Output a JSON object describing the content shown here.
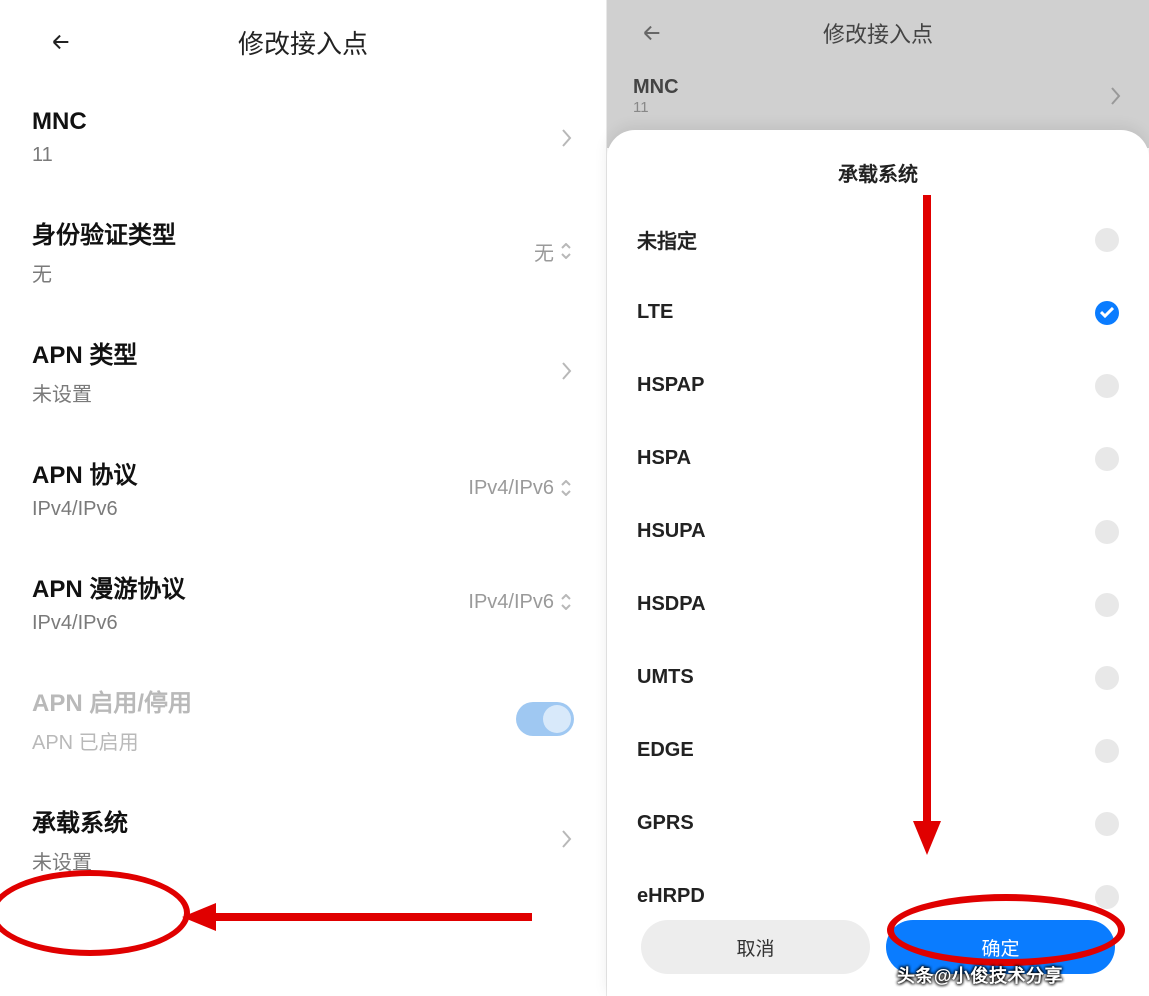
{
  "left": {
    "page_title": "修改接入点",
    "rows": [
      {
        "title": "MNC",
        "sub": "11",
        "tail_type": "chevron"
      },
      {
        "title": "身份验证类型",
        "sub": "无",
        "tail_type": "value-sort",
        "tail_value": "无"
      },
      {
        "title": "APN 类型",
        "sub": "未设置",
        "tail_type": "chevron"
      },
      {
        "title": "APN 协议",
        "sub": "IPv4/IPv6",
        "tail_type": "value-sort",
        "tail_value": "IPv4/IPv6"
      },
      {
        "title": "APN 漫游协议",
        "sub": "IPv4/IPv6",
        "tail_type": "value-sort",
        "tail_value": "IPv4/IPv6"
      },
      {
        "title": "APN 启用/停用",
        "sub": "APN 已启用",
        "tail_type": "toggle",
        "disabled": true
      },
      {
        "title": "承载系统",
        "sub": "未设置",
        "tail_type": "chevron"
      }
    ]
  },
  "right": {
    "page_title": "修改接入点",
    "dim_row": {
      "title": "MNC",
      "sub": "11"
    },
    "popup": {
      "title": "承载系统",
      "options": [
        {
          "label": "未指定",
          "checked": false
        },
        {
          "label": "LTE",
          "checked": true
        },
        {
          "label": "HSPAP",
          "checked": false
        },
        {
          "label": "HSPA",
          "checked": false
        },
        {
          "label": "HSUPA",
          "checked": false
        },
        {
          "label": "HSDPA",
          "checked": false
        },
        {
          "label": "UMTS",
          "checked": false
        },
        {
          "label": "EDGE",
          "checked": false
        },
        {
          "label": "GPRS",
          "checked": false
        },
        {
          "label": "eHRPD",
          "checked": false
        }
      ],
      "cancel": "取消",
      "confirm": "确定"
    }
  },
  "watermark": "头条@小俊技术分享"
}
